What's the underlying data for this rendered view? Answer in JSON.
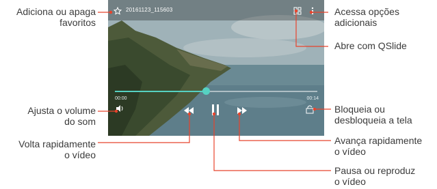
{
  "player": {
    "filename": "20161123_115603",
    "current_time": "00:00",
    "total_time": "00:14",
    "progress": 0.45
  },
  "callouts": {
    "favorites": [
      "Adiciona ou apaga",
      "favoritos"
    ],
    "more_options": [
      "Acessa opções",
      "adicionais"
    ],
    "qslide": [
      "Abre com QSlide"
    ],
    "volume": [
      "Ajusta o volume",
      "do som"
    ],
    "lock": [
      "Bloqueia ou",
      "desbloqueia a tela"
    ],
    "rewind": [
      "Volta rapidamente",
      "o vídeo"
    ],
    "forward": [
      "Avança rapidamente",
      "o vídeo"
    ],
    "play_pause": [
      "Pausa ou reproduz",
      "o vídeo"
    ]
  },
  "colors": {
    "accent": "#56d1c2",
    "callout_line": "#e8432c"
  },
  "icons": [
    "star-icon",
    "qslide-icon",
    "more-icon",
    "volume-icon",
    "rewind-icon",
    "pause-icon",
    "forward-icon",
    "lock-icon"
  ]
}
